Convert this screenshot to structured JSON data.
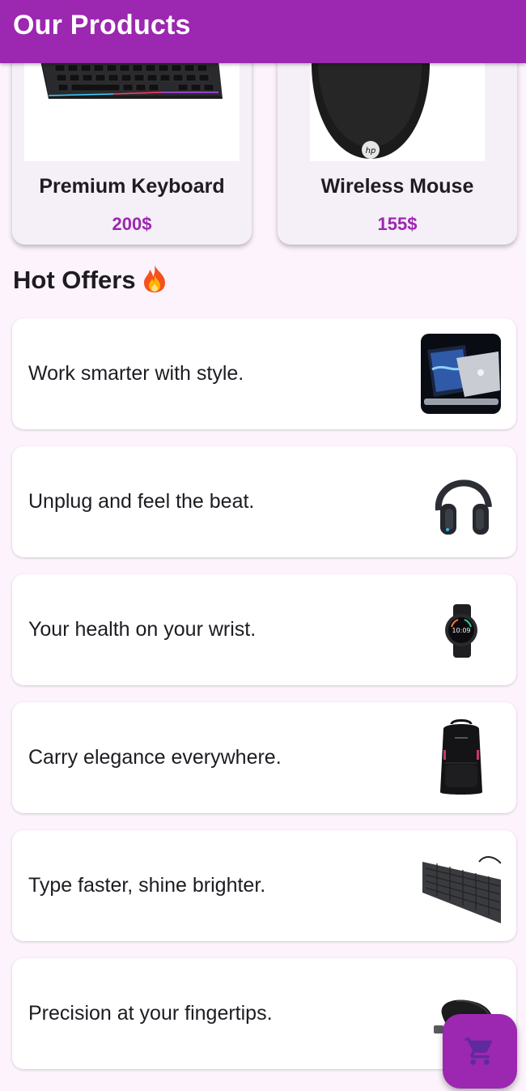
{
  "app_bar": {
    "title": "Our Products"
  },
  "products": [
    {
      "name": "Premium Keyboard",
      "price": "200$",
      "image": "keyboard-image"
    },
    {
      "name": "Wireless Mouse",
      "price": "155$",
      "image": "mouse-image"
    }
  ],
  "hot_offers": {
    "title": "Hot Offers",
    "emoji_icon": "fire-icon",
    "items": [
      {
        "text": "Work smarter with style.",
        "image": "laptop-image"
      },
      {
        "text": "Unplug and feel the beat.",
        "image": "headphones-image"
      },
      {
        "text": "Your health on your wrist.",
        "image": "smartwatch-image"
      },
      {
        "text": "Carry elegance everywhere.",
        "image": "backpack-image"
      },
      {
        "text": "Type faster, shine brighter.",
        "image": "keyboard-image"
      },
      {
        "text": "Precision at your fingertips.",
        "image": "mouse-image"
      }
    ]
  },
  "fab": {
    "icon": "shopping-cart-icon"
  },
  "colors": {
    "primary": "#9c27b0",
    "background": "#fcf3fc",
    "card": "#f5eff7"
  }
}
